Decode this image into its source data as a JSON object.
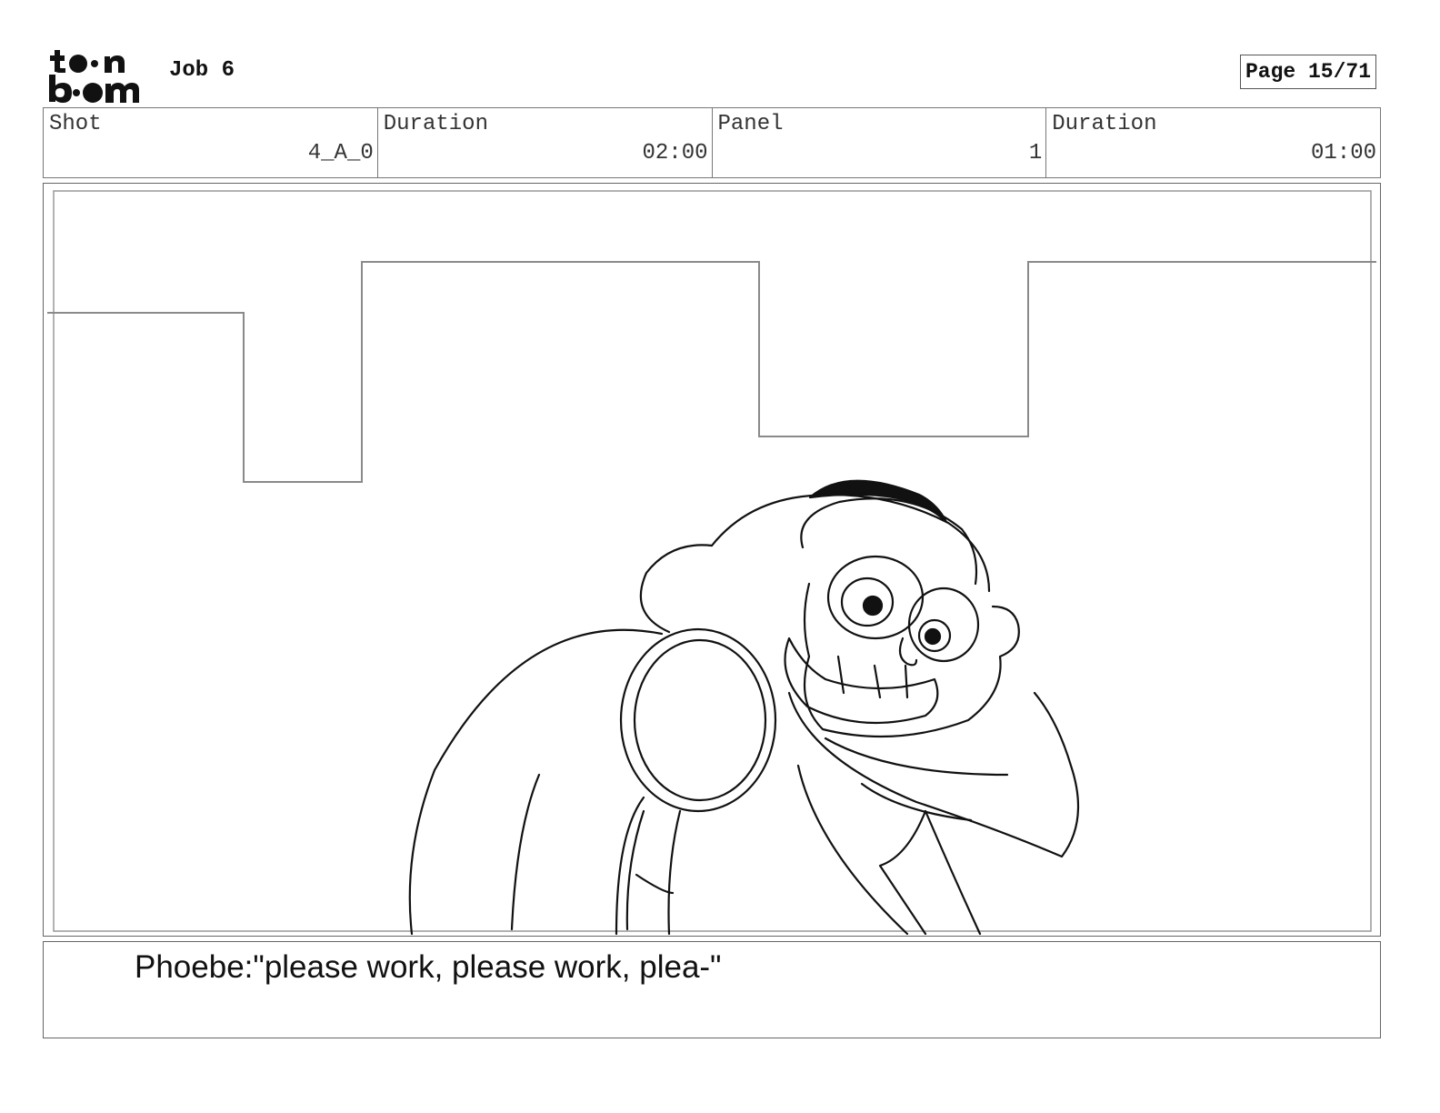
{
  "header": {
    "logo_text": "toon boom",
    "job_title": "Job 6",
    "page_label": "Page 15/71"
  },
  "info": {
    "shot_label": "Shot",
    "shot_value": "4_A_0",
    "duration_label": "Duration",
    "duration_value": "02:00",
    "panel_label": "Panel",
    "panel_value": "1",
    "panel_duration_label": "Duration",
    "panel_duration_value": "01:00"
  },
  "dialogue": {
    "text": "Phoebe:\"please work, please work, plea-\""
  },
  "icons": {
    "logo": "toon-boom-logo"
  }
}
